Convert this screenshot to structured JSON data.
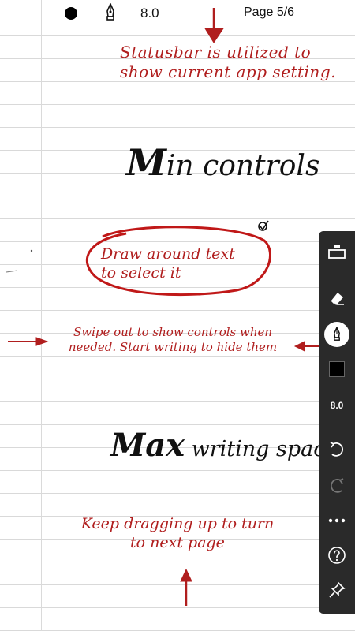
{
  "statusbar": {
    "pen_width": "8.0",
    "page_indicator": "Page 5/6",
    "color_hex": "#000000"
  },
  "notes": {
    "statusbar_note": "Statusbar is utilized to show current app setting.",
    "min_title_initial": "M",
    "min_title_rest": "in controls",
    "draw_note": "Draw around text to select it",
    "swipe_note": "Swipe out to show controls when needed. Start writing to hide them",
    "max_title_initial": "Max",
    "max_title_rest": " writing space",
    "drag_note": "Keep dragging up to turn to next page"
  },
  "toolbar": {
    "width_label": "8.0",
    "color_hex": "#000000",
    "items": [
      "toolbar-icon",
      "eraser-icon",
      "pen-icon",
      "color-swatch",
      "width",
      "undo-icon",
      "redo-icon",
      "more-icon",
      "help-icon",
      "pin-icon"
    ]
  },
  "colors": {
    "annotation": "#b01e1e",
    "toolbar_bg": "#2a2a2a",
    "ruled_line": "#d9d9d9"
  }
}
